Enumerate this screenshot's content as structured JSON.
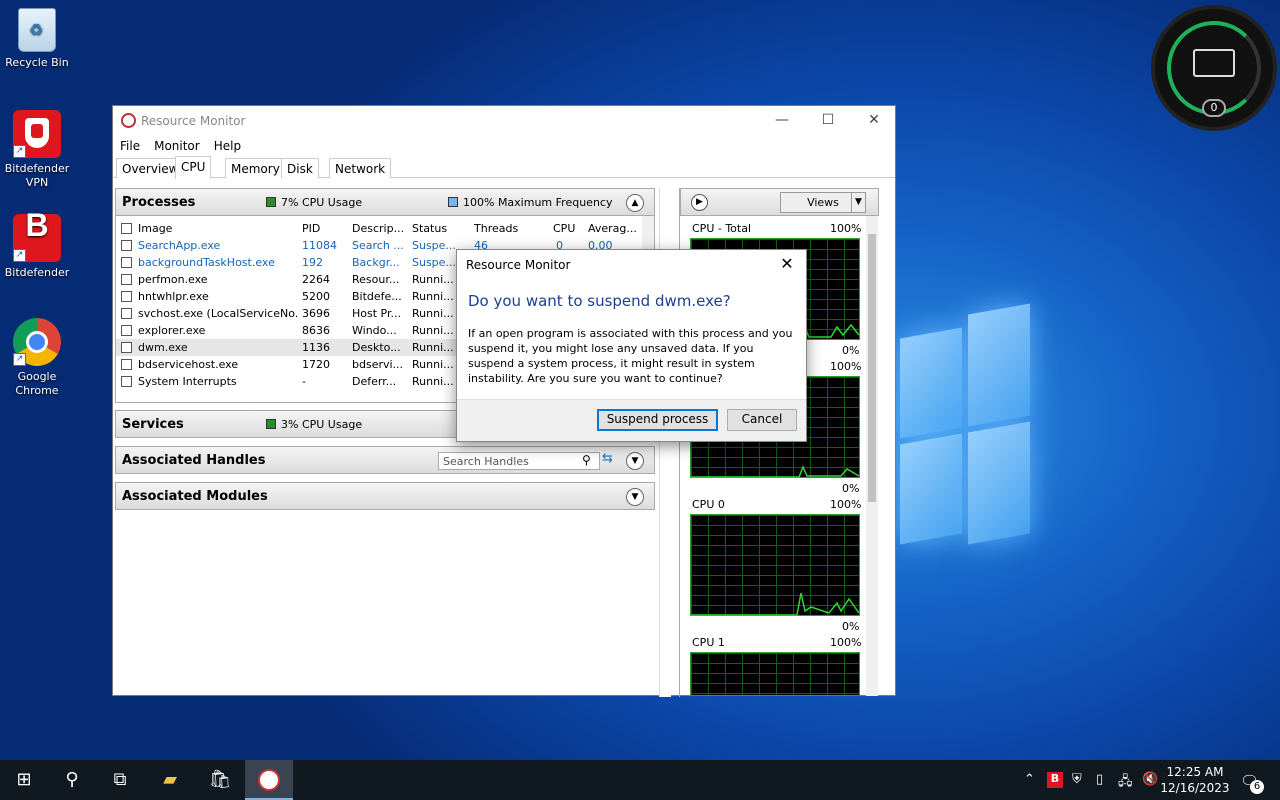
{
  "desktop": {
    "icons": [
      {
        "label": "Recycle Bin"
      },
      {
        "label": "Bitdefender VPN"
      },
      {
        "label": "Bitdefender"
      },
      {
        "label": "Google Chrome"
      }
    ],
    "widget_count": "0"
  },
  "window": {
    "title": "Resource Monitor",
    "menu": [
      "File",
      "Monitor",
      "Help"
    ],
    "tabs": [
      "Overview",
      "CPU",
      "Memory",
      "Disk",
      "Network"
    ],
    "selected_tab": "CPU"
  },
  "processes": {
    "title": "Processes",
    "cpu_usage": "7% CPU Usage",
    "max_freq": "100% Maximum Frequency",
    "columns": [
      "Image",
      "PID",
      "Descrip...",
      "Status",
      "Threads",
      "CPU",
      "Averag..."
    ],
    "rows": [
      {
        "image": "SearchApp.exe",
        "pid": "11084",
        "desc": "Search ...",
        "status": "Suspe...",
        "threads": "46",
        "cpu": "0",
        "avg": "0.00"
      },
      {
        "image": "backgroundTaskHost.exe",
        "pid": "192",
        "desc": "Backgr...",
        "status": "Suspe...",
        "threads": "",
        "cpu": "",
        "avg": ""
      },
      {
        "image": "perfmon.exe",
        "pid": "2264",
        "desc": "Resour...",
        "status": "Runni...",
        "threads": "",
        "cpu": "",
        "avg": ""
      },
      {
        "image": "hntwhlpr.exe",
        "pid": "5200",
        "desc": "Bitdefe...",
        "status": "Runni...",
        "threads": "",
        "cpu": "",
        "avg": ""
      },
      {
        "image": "svchost.exe (LocalServiceNo...",
        "pid": "3696",
        "desc": "Host Pr...",
        "status": "Runni...",
        "threads": "",
        "cpu": "",
        "avg": ""
      },
      {
        "image": "explorer.exe",
        "pid": "8636",
        "desc": "Windo...",
        "status": "Runni...",
        "threads": "",
        "cpu": "",
        "avg": ""
      },
      {
        "image": "dwm.exe",
        "pid": "1136",
        "desc": "Deskto...",
        "status": "Runni...",
        "threads": "",
        "cpu": "",
        "avg": ""
      },
      {
        "image": "bdservicehost.exe",
        "pid": "1720",
        "desc": "bdservi...",
        "status": "Runni...",
        "threads": "",
        "cpu": "",
        "avg": ""
      },
      {
        "image": "System Interrupts",
        "pid": "-",
        "desc": "Deferr...",
        "status": "Runni...",
        "threads": "",
        "cpu": "",
        "avg": ""
      }
    ]
  },
  "services": {
    "title": "Services",
    "cpu_usage": "3% CPU Usage"
  },
  "handles": {
    "title": "Associated Handles",
    "search_placeholder": "Search Handles"
  },
  "modules": {
    "title": "Associated Modules"
  },
  "right_panel": {
    "views_label": "Views",
    "graphs": [
      {
        "label": "CPU - Total",
        "max": "100%",
        "min": "0%"
      },
      {
        "label": "",
        "max": "100%",
        "min": "0%"
      },
      {
        "label": "CPU 0",
        "max": "100%",
        "min": "0%"
      },
      {
        "label": "CPU 1",
        "max": "100%",
        "min": ""
      }
    ]
  },
  "dialog": {
    "title": "Resource Monitor",
    "question": "Do you want to suspend dwm.exe?",
    "message": "If an open program is associated with this process and you suspend it, you might lose any unsaved data. If you suspend a system process, it might result in system instability. Are you sure you want to continue?",
    "confirm": "Suspend process",
    "cancel": "Cancel"
  },
  "taskbar": {
    "time": "12:25 AM",
    "date": "12/16/2023",
    "notifications": "6"
  },
  "colors": {
    "accent": "#0078d7",
    "link_blue": "#1463b8",
    "graph_green": "#2fd62f"
  }
}
